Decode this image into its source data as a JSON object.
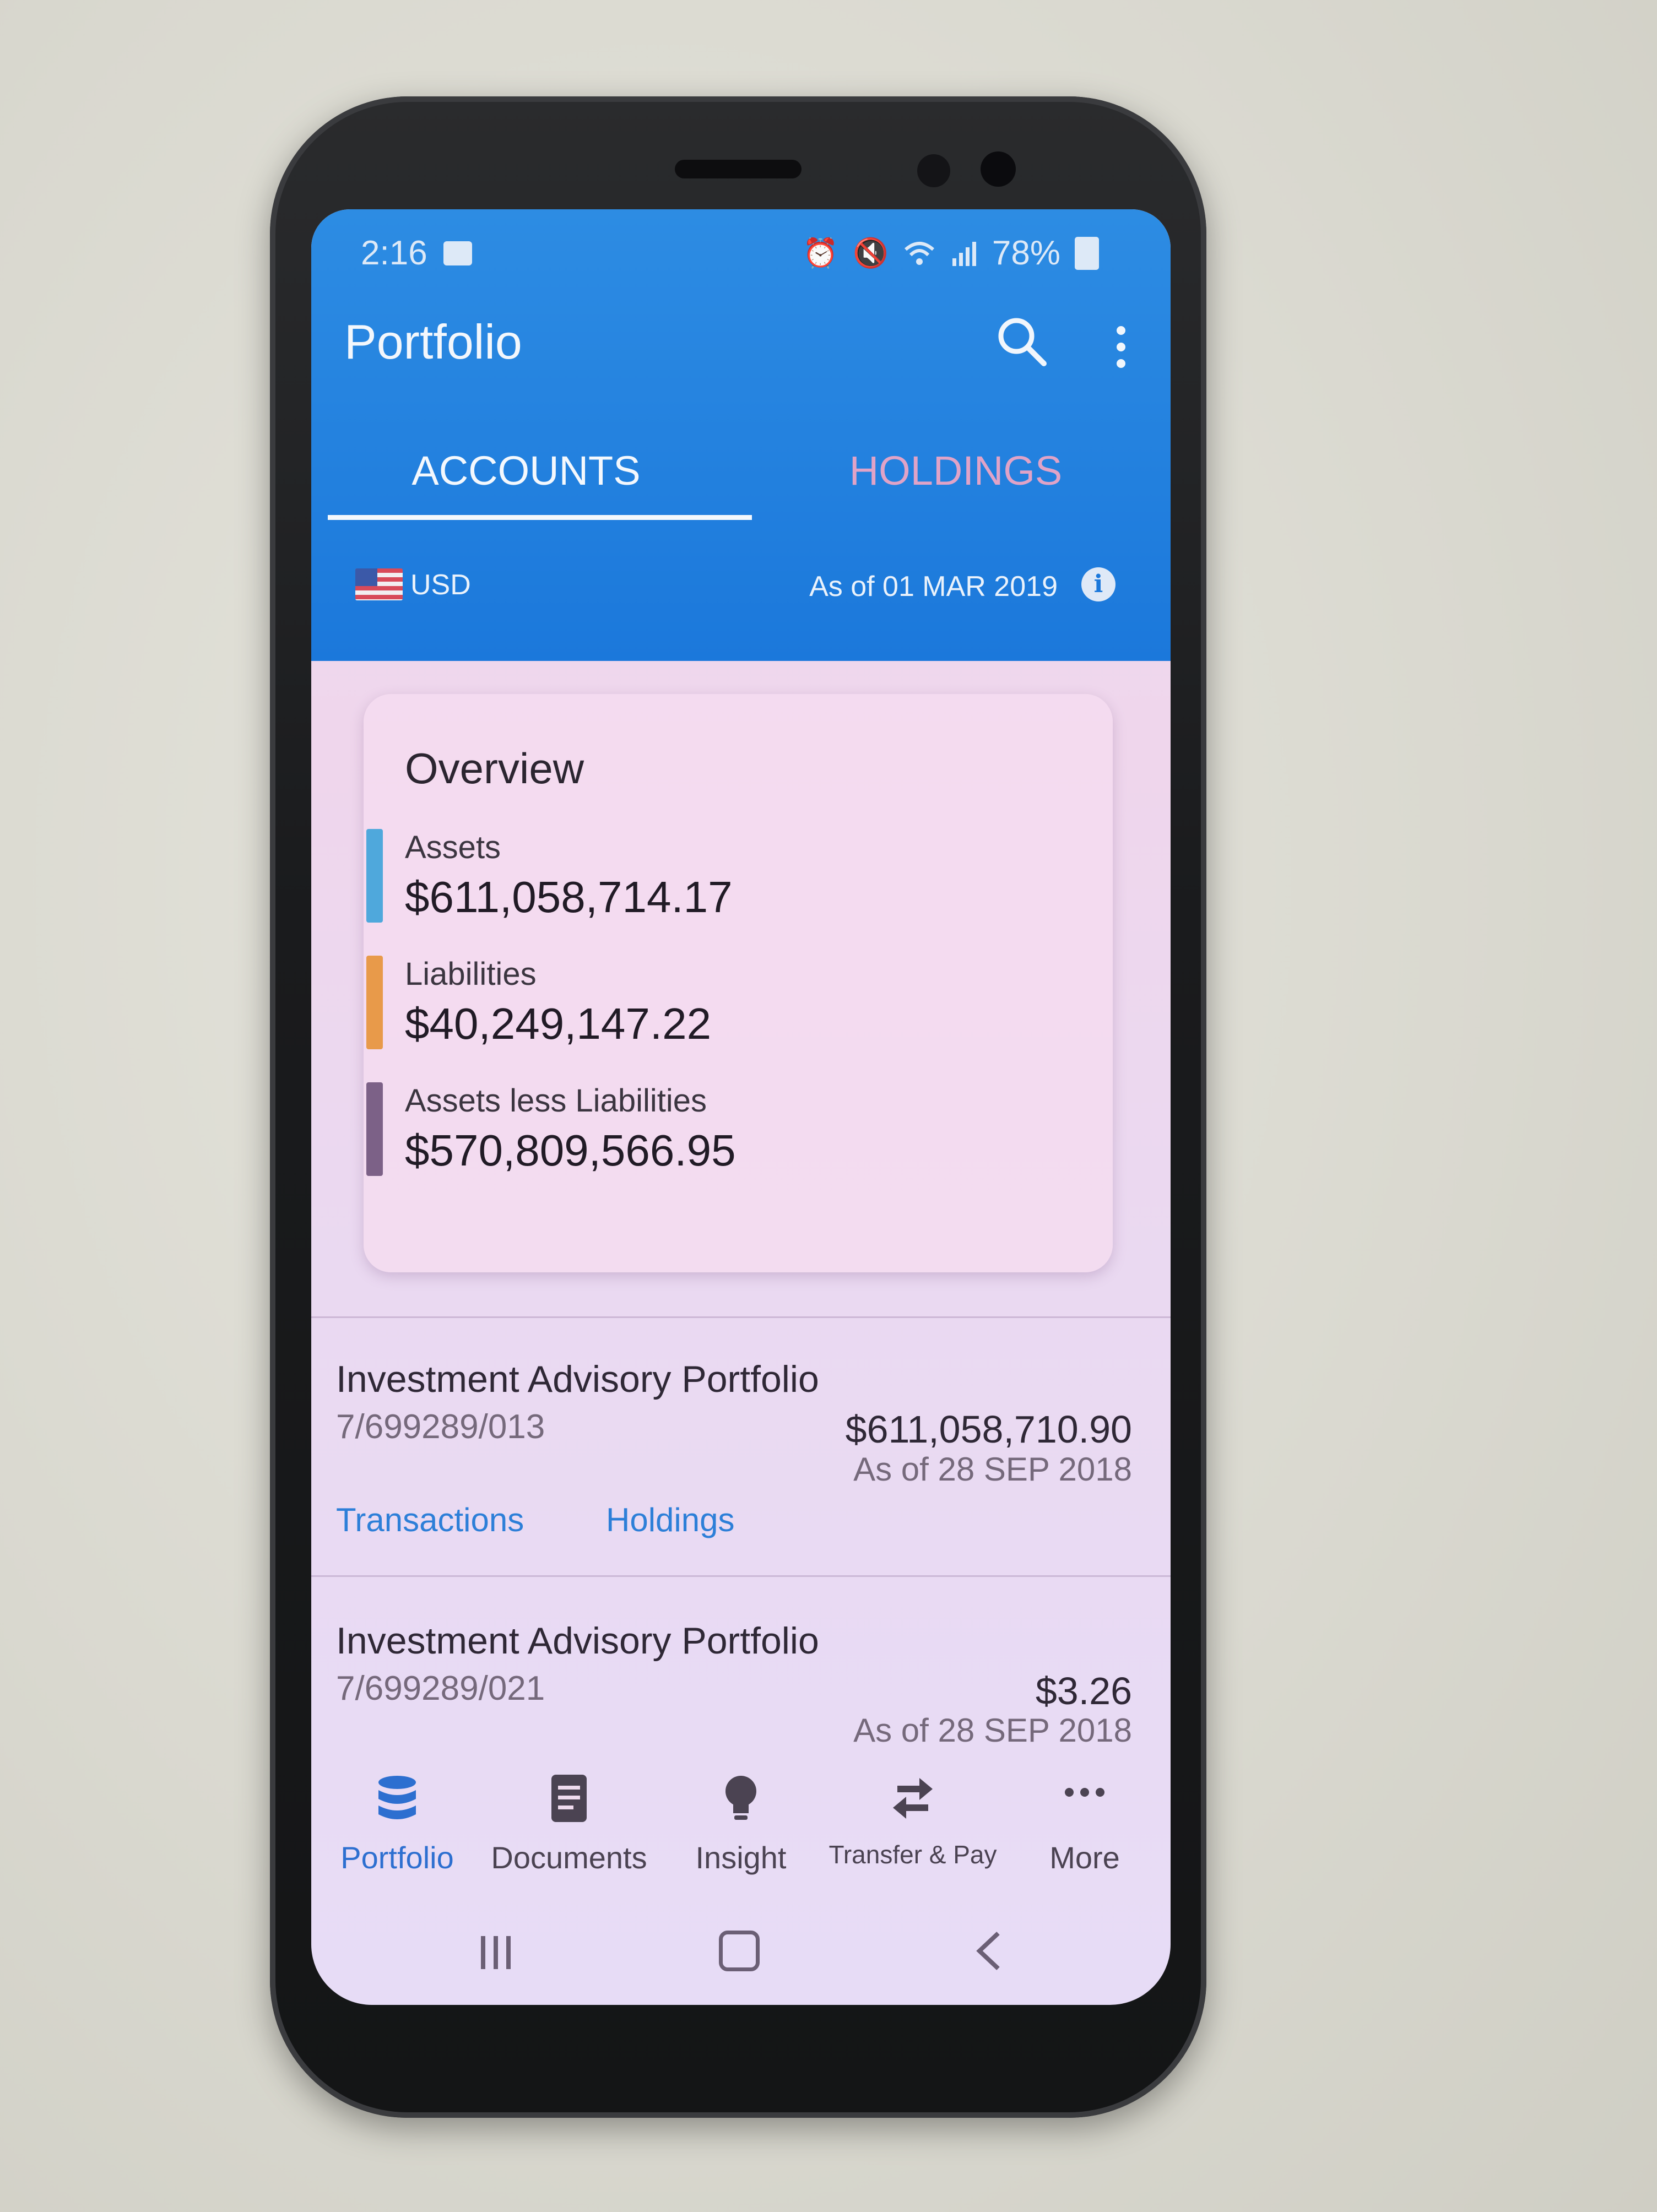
{
  "status_bar": {
    "time": "2:16",
    "battery": "78%"
  },
  "app_bar": {
    "title": "Portfolio"
  },
  "tabs": [
    {
      "label": "ACCOUNTS",
      "active": true
    },
    {
      "label": "HOLDINGS",
      "active": false
    }
  ],
  "currency": {
    "code": "USD",
    "as_of": "As of 01 MAR 2019"
  },
  "overview": {
    "title": "Overview",
    "metrics": [
      {
        "label": "Assets",
        "value": "$611,058,714.17",
        "color": "#4fa8dc"
      },
      {
        "label": "Liabilities",
        "value": "$40,249,147.22",
        "color": "#e89a4a"
      },
      {
        "label": "Assets less Liabilities",
        "value": "$570,809,566.95",
        "color": "#7c6187"
      }
    ]
  },
  "accounts": [
    {
      "name": "Investment Advisory Portfolio",
      "number": "7/699289/013",
      "value": "$611,058,710.90",
      "as_of": "As of 28 SEP 2018",
      "links": [
        "Transactions",
        "Holdings"
      ]
    },
    {
      "name": "Investment Advisory Portfolio",
      "number": "7/699289/021",
      "value": "$3.26",
      "as_of": "As of 28 SEP 2018"
    }
  ],
  "bottom_nav": [
    {
      "label": "Portfolio",
      "icon": "database-icon",
      "active": true
    },
    {
      "label": "Documents",
      "icon": "document-icon",
      "active": false
    },
    {
      "label": "Insight",
      "icon": "lightbulb-icon",
      "active": false
    },
    {
      "label": "Transfer & Pay",
      "icon": "transfer-icon",
      "active": false
    },
    {
      "label": "More",
      "icon": "more-horizontal-icon",
      "active": false
    }
  ],
  "colors": {
    "app_bar": "#1b78db",
    "link": "#2d7fd8",
    "active_nav": "#2d6fd0"
  }
}
